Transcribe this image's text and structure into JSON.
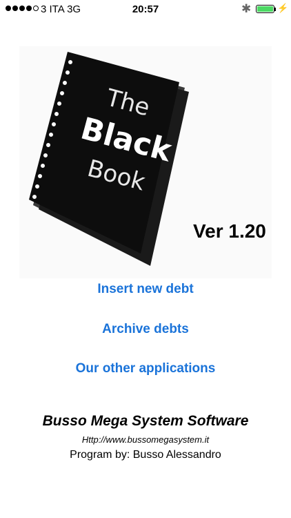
{
  "status_bar": {
    "carrier": "3 ITA   3G",
    "time": "20:57",
    "signal_bars_filled": 4,
    "signal_bars_total": 5,
    "battery_level": 1.0,
    "icons": [
      "signal-dots",
      "bluetooth-icon",
      "battery-icon",
      "charging-bolt-icon"
    ]
  },
  "logo": {
    "line1": "The",
    "line2": "Black",
    "line3": "Book"
  },
  "version": "Ver 1.20",
  "menu": {
    "insert_label": "Insert new debt",
    "archive_label": "Archive debts",
    "other_apps_label": "Our other applications"
  },
  "credits": {
    "company": "Busso Mega System Software",
    "website": "Http://www.bussomegasystem.it",
    "author": "Program by: Busso Alessandro"
  },
  "colors": {
    "link": "#1a73d9",
    "battery": "#4cd964",
    "book_cover": "#0d0d0d"
  }
}
